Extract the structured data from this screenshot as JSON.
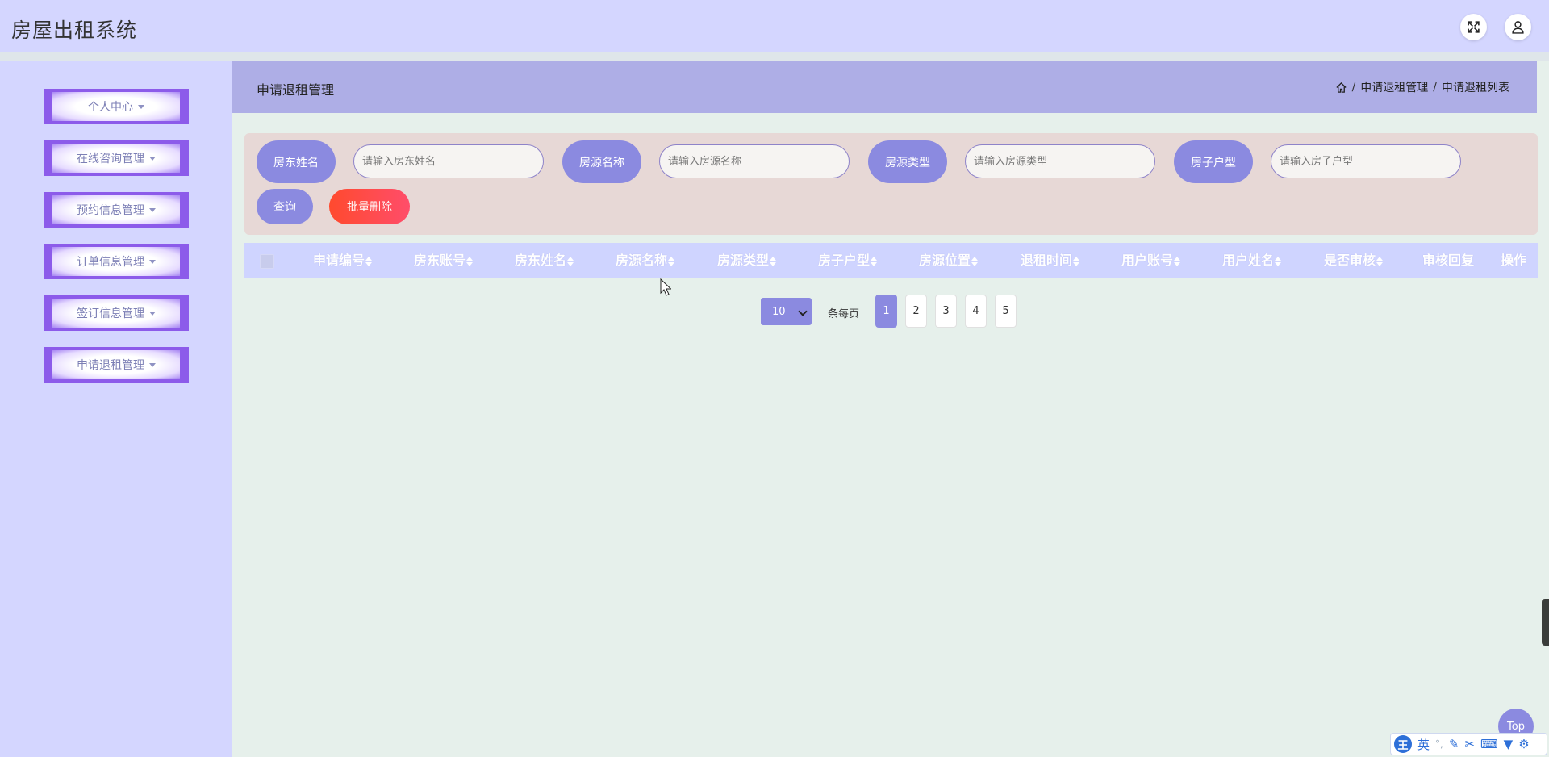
{
  "app": {
    "title": "房屋出租系统"
  },
  "topbar": {
    "fullscreen_icon": "fullscreen-icon",
    "user_icon": "user-icon"
  },
  "sidebar": {
    "items": [
      {
        "label": "个人中心"
      },
      {
        "label": "在线咨询管理"
      },
      {
        "label": "预约信息管理"
      },
      {
        "label": "订单信息管理"
      },
      {
        "label": "签订信息管理"
      },
      {
        "label": "申请退租管理"
      }
    ]
  },
  "header": {
    "title": "申请退租管理",
    "breadcrumb": [
      "申请退租管理",
      "申请退租列表"
    ],
    "breadcrumb_separator": "/"
  },
  "search": {
    "fields": [
      {
        "label": "房东姓名",
        "placeholder": "请输入房东姓名",
        "value": ""
      },
      {
        "label": "房源名称",
        "placeholder": "请输入房源名称",
        "value": ""
      },
      {
        "label": "房源类型",
        "placeholder": "请输入房源类型",
        "value": ""
      },
      {
        "label": "房子户型",
        "placeholder": "请输入房子户型",
        "value": ""
      }
    ],
    "query_label": "查询",
    "batch_delete_label": "批量删除"
  },
  "table": {
    "columns": [
      "申请编号",
      "房东账号",
      "房东姓名",
      "房源名称",
      "房源类型",
      "房子户型",
      "房源位置",
      "退租时间",
      "用户账号",
      "用户姓名",
      "是否审核",
      "审核回复",
      "操作"
    ],
    "rows": []
  },
  "pagination": {
    "page_size": "10",
    "per_page_label": "条每页",
    "pages": [
      "1",
      "2",
      "3",
      "4",
      "5"
    ],
    "current_page": "1"
  },
  "floating": {
    "top_label": "Top"
  },
  "ime": {
    "logo": "王",
    "mode": "英"
  },
  "colors": {
    "topbar": "#d4d6ff",
    "accent": "#8b8ae0",
    "header": "#aeaee6",
    "danger": "#ff4a2e",
    "sidebar_border": "#8c5bea"
  }
}
